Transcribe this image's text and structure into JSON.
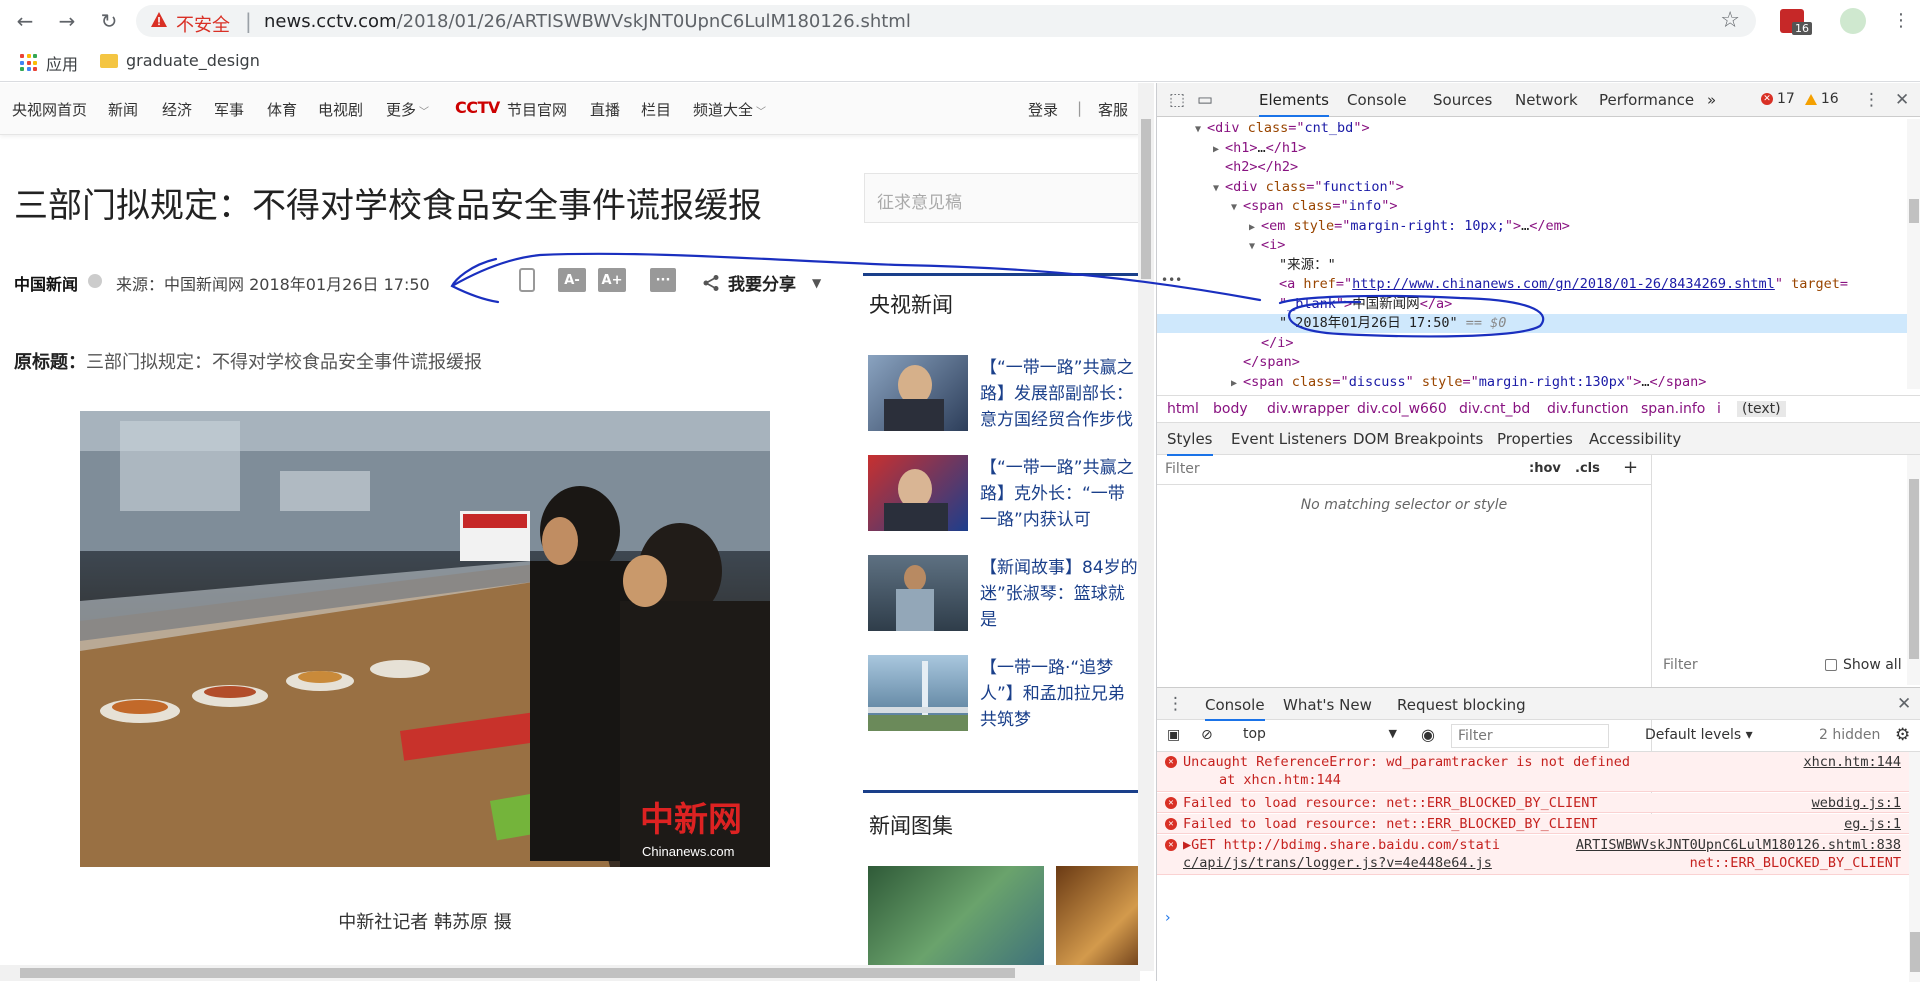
{
  "browser": {
    "not_secure": "不安全",
    "url_host": "news.cctv.com",
    "url_path": "/2018/01/26/ARTISWBWVskJNT0UpnC6LulM180126.shtml",
    "extension_badge": "16",
    "bookmarks": [
      {
        "label": "应用",
        "icon": "apps-grid-icon"
      },
      {
        "label": "graduate_design",
        "icon": "folder-icon"
      }
    ]
  },
  "site_nav": {
    "items": [
      "央视网首页",
      "新闻",
      "经济",
      "军事",
      "体育",
      "电视剧",
      "更多"
    ],
    "logo": "CCTV",
    "logo_suffix": "节目官网",
    "items2": [
      "直播",
      "栏目",
      "频道大全"
    ],
    "login": "登录",
    "divider": "|",
    "service": "客服"
  },
  "article": {
    "title": "三部门拟规定：不得对学校食品安全事件谎报缓报",
    "source_name": "中国新闻",
    "source_line": "来源：中国新闻网 2018年01月26日 17:50",
    "font_minus": "A-",
    "font_plus": "A+",
    "comment": "···",
    "share": "我要分享",
    "orig_title_label": "原标题：",
    "orig_title": "三部门拟规定：不得对学校食品安全事件谎报缓报",
    "photo_watermark": "中新网",
    "photo_watermark_sub": "Chinanews.com",
    "caption": "中新社记者 韩苏原 摄"
  },
  "sidebar": {
    "search_placeholder": "征求意见稿",
    "cctv_news_title": "央视新闻",
    "news": [
      "【“一带一路”共赢之路】发展部副部长：意方国经贸合作步伐",
      "【“一带一路”共赢之路】克外长：“一带一路”内获认可",
      "【新闻故事】84岁的迷”张淑琴：篮球就是",
      "【一带一路·“追梦人”】和孟加拉兄弟共筑梦"
    ],
    "photos_title": "新闻图集"
  },
  "devtools": {
    "tabs": [
      "Elements",
      "Console",
      "Sources",
      "Network",
      "Performance",
      "»"
    ],
    "error_count": "17",
    "warning_count": "16",
    "dom": [
      {
        "indent": 3,
        "tri": "▼",
        "html": [
          [
            "tag",
            "<div "
          ],
          [
            "attr",
            "class"
          ],
          [
            "tag",
            "=\""
          ],
          [
            "val",
            "cnt_bd"
          ],
          [
            "tag",
            "\">"
          ]
        ]
      },
      {
        "indent": 4,
        "tri": "▶",
        "html": [
          [
            "tag",
            "<h1>"
          ],
          [
            "txt",
            "…"
          ],
          [
            "tag",
            "</h1>"
          ]
        ]
      },
      {
        "indent": 4,
        "tri": "",
        "html": [
          [
            "tag",
            "<h2></h2>"
          ]
        ]
      },
      {
        "indent": 4,
        "tri": "▼",
        "html": [
          [
            "tag",
            "<div "
          ],
          [
            "attr",
            "class"
          ],
          [
            "tag",
            "=\""
          ],
          [
            "val",
            "function"
          ],
          [
            "tag",
            "\">"
          ]
        ]
      },
      {
        "indent": 5,
        "tri": "▼",
        "html": [
          [
            "tag",
            "<span "
          ],
          [
            "attr",
            "class"
          ],
          [
            "tag",
            "=\""
          ],
          [
            "val",
            "info"
          ],
          [
            "tag",
            "\">"
          ]
        ]
      },
      {
        "indent": 6,
        "tri": "▶",
        "html": [
          [
            "tag",
            "<em "
          ],
          [
            "attr",
            "style"
          ],
          [
            "tag",
            "=\""
          ],
          [
            "val",
            "margin-right: 10px;"
          ],
          [
            "tag",
            "\">"
          ],
          [
            "txt",
            "…"
          ],
          [
            "tag",
            "</em>"
          ]
        ]
      },
      {
        "indent": 6,
        "tri": "▼",
        "html": [
          [
            "tag",
            "<i>"
          ]
        ]
      },
      {
        "indent": 7,
        "tri": "",
        "html": [
          [
            "txt",
            "\"来源：\""
          ]
        ]
      },
      {
        "indent": 7,
        "tri": "",
        "html": [
          [
            "tag",
            "<a "
          ],
          [
            "attr",
            "href"
          ],
          [
            "tag",
            "=\""
          ],
          [
            "link",
            "http://www.chinanews.com/gn/2018/01-26/8434269.shtml"
          ],
          [
            "tag",
            "\" "
          ],
          [
            "attr",
            "target"
          ],
          [
            "tag",
            "="
          ]
        ]
      },
      {
        "indent": 7,
        "tri": "",
        "html": [
          [
            "tag",
            "\""
          ],
          [
            "val",
            "_blank"
          ],
          [
            "tag",
            "\">"
          ],
          [
            "txt",
            "中国新闻网"
          ],
          [
            "tag",
            "</a>"
          ]
        ]
      },
      {
        "indent": 7,
        "tri": "",
        "html": [
          [
            "txt",
            "\" 2018年01月26日 17:50\""
          ],
          [
            "dim",
            " == $0"
          ]
        ],
        "selected": true
      },
      {
        "indent": 6,
        "tri": "",
        "html": [
          [
            "tag",
            "</i>"
          ]
        ]
      },
      {
        "indent": 5,
        "tri": "",
        "html": [
          [
            "tag",
            "</span>"
          ]
        ]
      },
      {
        "indent": 5,
        "tri": "▶",
        "html": [
          [
            "tag",
            "<span "
          ],
          [
            "attr",
            "class"
          ],
          [
            "tag",
            "=\""
          ],
          [
            "val",
            "discuss"
          ],
          [
            "tag",
            "\" "
          ],
          [
            "attr",
            "style"
          ],
          [
            "tag",
            "=\""
          ],
          [
            "val",
            "margin-right:130px"
          ],
          [
            "tag",
            "\">"
          ],
          [
            "txt",
            "…"
          ],
          [
            "tag",
            "</span>"
          ]
        ]
      }
    ],
    "breadcrumbs": [
      "html",
      "body",
      "div.wrapper",
      "div.col_w660",
      "div.cnt_bd",
      "div.function",
      "span.info",
      "i",
      "(text)"
    ],
    "styles_tabs": [
      "Styles",
      "Event Listeners",
      "DOM Breakpoints",
      "Properties",
      "Accessibility"
    ],
    "styles_filter": "Filter",
    "hov": ":hov",
    "cls": ".cls",
    "no_match": "No matching selector or style",
    "computed_filter": "Filter",
    "show_all": "Show all",
    "drawer_tabs": [
      "Console",
      "What's New",
      "Request blocking"
    ],
    "context": "top",
    "console_filter": "Filter",
    "levels": "Default levels ▾",
    "hidden": "2 hidden",
    "messages": [
      {
        "text": "Uncaught ReferenceError: wd_paramtracker is not defined",
        "text2": "at xhcn.htm:144",
        "src": "xhcn.htm:144"
      },
      {
        "text": "Failed to load resource: net::ERR_BLOCKED_BY_CLIENT",
        "src": "webdig.js:1"
      },
      {
        "text": "Failed to load resource: net::ERR_BLOCKED_BY_CLIENT",
        "src": "eg.js:1"
      },
      {
        "text": "▶GET http://bdimg.share.baidu.com/stati",
        "text2": "c/api/js/trans/logger.js?v=4e448e64.js",
        "src": "ARTISWBWVskJNT0UpnC6LulM180126.shtml:838",
        "src2": "net::ERR_BLOCKED_BY_CLIENT"
      }
    ]
  }
}
